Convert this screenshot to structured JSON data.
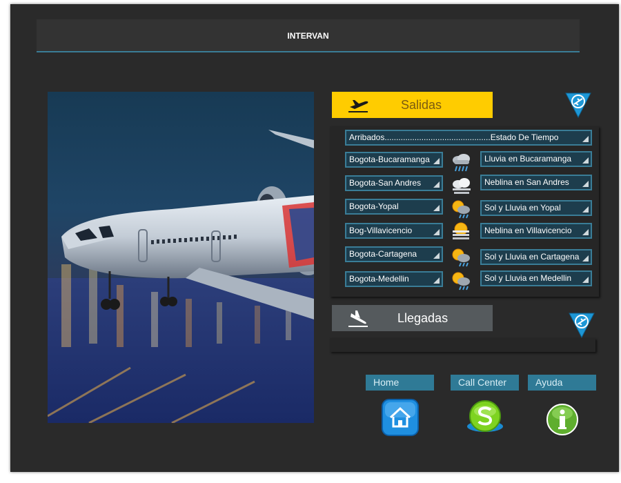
{
  "header": {
    "title": "INTERVAN"
  },
  "salidas": {
    "label": "Salidas",
    "header_select": "Arribados..............................................Estado De Tiempo",
    "rows": [
      {
        "route": "Bogota-Bucaramanga",
        "weather_icon": "rain-cloud-icon",
        "status": "Lluvia en Bucaramanga"
      },
      {
        "route": "Bogota-San Andres",
        "weather_icon": "fog-cloud-icon",
        "status": "Neblina en San Andres"
      },
      {
        "route": "Bogota-Yopal",
        "weather_icon": "sun-rain-icon",
        "status": "Sol y Lluvia en Yopal"
      },
      {
        "route": "Bog-Villavicencio",
        "weather_icon": "sun-fog-icon",
        "status": "Neblina en Villavicencio"
      },
      {
        "route": "Bogota-Cartagena",
        "weather_icon": "sun-rain-icon",
        "status": "Sol y Lluvia en Cartagena"
      },
      {
        "route": "Bogota-Medellin",
        "weather_icon": "sun-rain-icon",
        "status": "Sol y Lluvia en Medellin"
      }
    ]
  },
  "llegadas": {
    "label": "Llegadas"
  },
  "nav": {
    "home": "Home",
    "call_center": "Call Center",
    "ayuda": "Ayuda"
  },
  "colors": {
    "accent": "#3a7d97",
    "salidas_tab": "#ffcc00",
    "llegadas_tab": "#555a5d",
    "background": "#2a2a2a"
  }
}
